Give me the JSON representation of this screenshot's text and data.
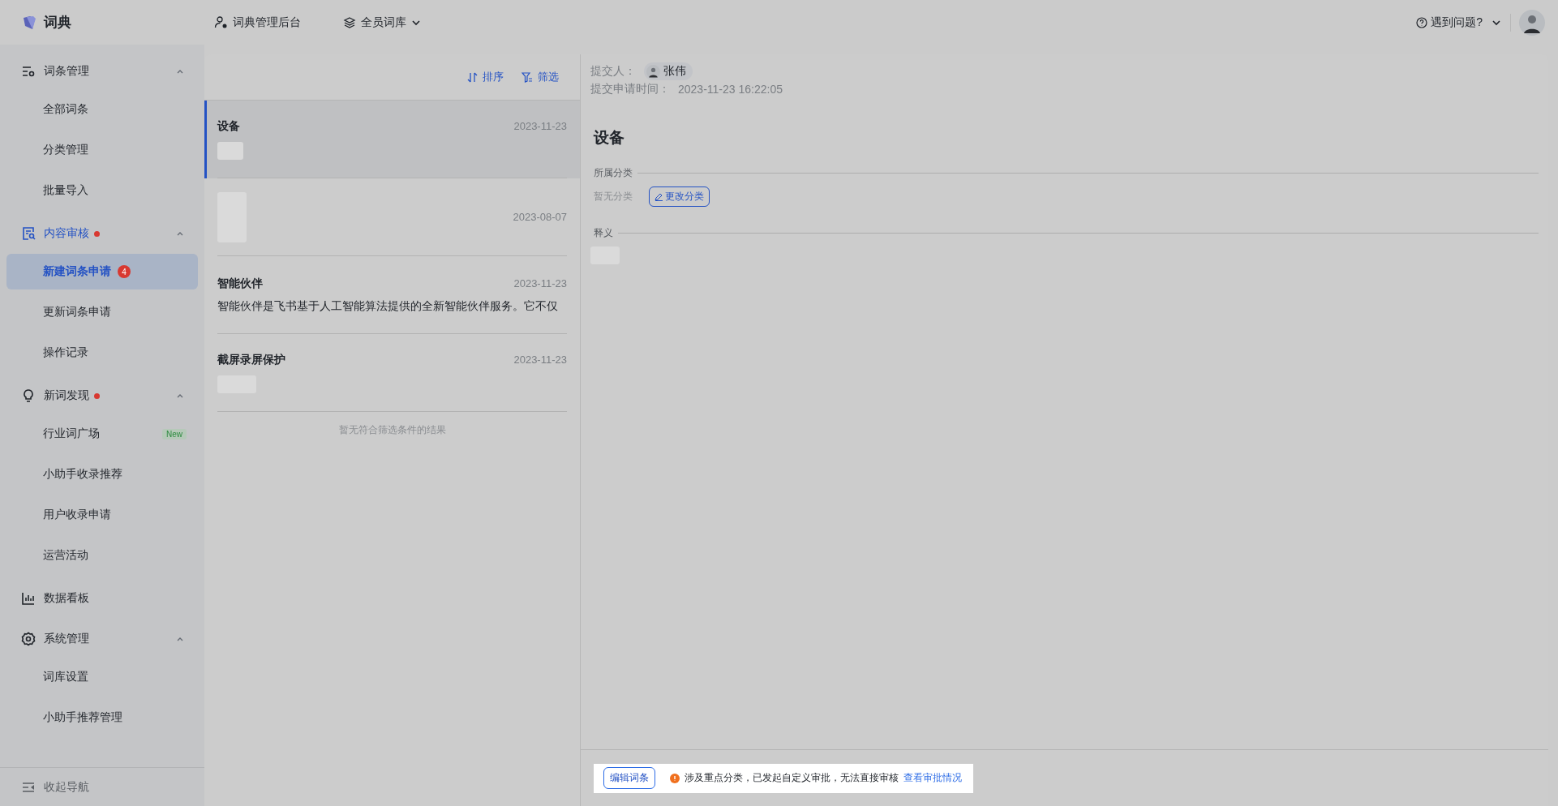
{
  "app": {
    "name": "词典"
  },
  "topbar": {
    "items": [
      {
        "kind": "admin",
        "label": "词典管理后台"
      },
      {
        "kind": "library",
        "label": "全员词库"
      }
    ],
    "help": "遇到问题?"
  },
  "sidebar": {
    "groups": [
      {
        "kind": "group",
        "label": "词条管理",
        "active": false,
        "dot": false,
        "expanded": true,
        "children": [
          {
            "label": "全部词条",
            "selected": false
          },
          {
            "label": "分类管理",
            "selected": false
          },
          {
            "label": "批量导入",
            "selected": false
          }
        ]
      },
      {
        "kind": "group",
        "label": "内容审核",
        "active": true,
        "dot": true,
        "expanded": true,
        "children": [
          {
            "label": "新建词条申请",
            "selected": true,
            "badge": "4"
          },
          {
            "label": "更新词条申请",
            "selected": false
          },
          {
            "label": "操作记录",
            "selected": false
          }
        ]
      },
      {
        "kind": "group",
        "label": "新词发现",
        "active": false,
        "dot": true,
        "expanded": true,
        "children": [
          {
            "label": "行业词广场",
            "selected": false,
            "tag": "New"
          },
          {
            "label": "小助手收录推荐",
            "selected": false
          },
          {
            "label": "用户收录申请",
            "selected": false
          },
          {
            "label": "运营活动",
            "selected": false
          }
        ]
      },
      {
        "kind": "link",
        "label": "数据看板",
        "active": false,
        "dot": false
      },
      {
        "kind": "group",
        "label": "系统管理",
        "active": false,
        "dot": false,
        "expanded": true,
        "children": [
          {
            "label": "词库设置",
            "selected": false
          },
          {
            "label": "小助手推荐管理",
            "selected": false
          }
        ]
      }
    ],
    "collapse": "收起导航"
  },
  "list": {
    "sort": "排序",
    "filter": "筛选",
    "items": [
      {
        "kind": "blurred-desc",
        "title": "设备",
        "date": "2023-11-23",
        "selected": true
      },
      {
        "kind": "blurred-all",
        "date": "2023-08-07",
        "selected": false
      },
      {
        "kind": "text",
        "title": "智能伙伴",
        "date": "2023-11-23",
        "desc": "智能伙伴是飞书基于人工智能算法提供的全新智能伙伴服务。它不仅",
        "selected": false
      },
      {
        "kind": "blurred-desc",
        "title": "截屏录屏保护",
        "date": "2023-11-23",
        "selected": false
      }
    ],
    "empty": "暂无符合筛选条件的结果"
  },
  "detail": {
    "submitter_label": "提交人：",
    "submitter": "张伟",
    "time_label": "提交申请时间：",
    "time": "2023-11-23 16:22:05",
    "title": "设备",
    "category_label": "所属分类",
    "category": "暂无分类",
    "change_button": "更改分类",
    "definition_label": "释义"
  },
  "footer": {
    "edit_button": "编辑词条",
    "warning": "涉及重点分类，已发起自定义审批，无法直接审核",
    "link": "查看审批情况"
  }
}
